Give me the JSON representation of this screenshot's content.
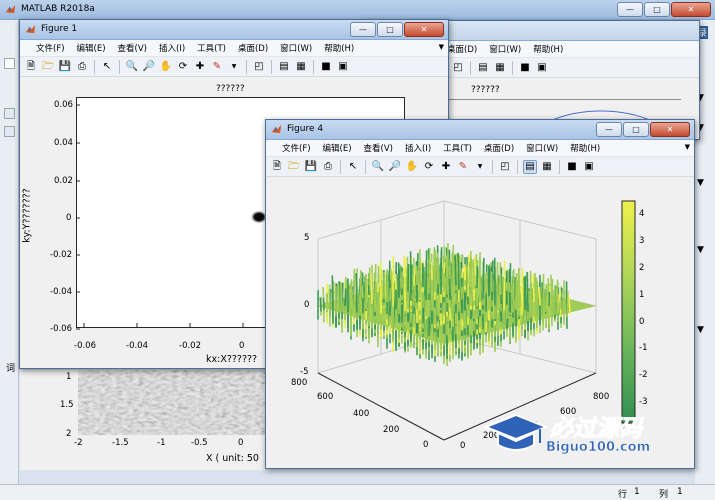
{
  "main": {
    "title": "MATLAB R2018a",
    "side_fragment": "录",
    "status": {
      "row_label": "行",
      "row_value": "1",
      "col_label": "列",
      "col_value": "1"
    }
  },
  "fig_menu": [
    "文件(F)",
    "编辑(E)",
    "查看(V)",
    "插入(I)",
    "工具(T)",
    "桌面(D)",
    "窗口(W)",
    "帮助(H)"
  ],
  "figure2": {
    "title": "??????"
  },
  "figure1": {
    "title": "Figure 1",
    "plot_title": "??????",
    "ylabel": "ky:Y???????",
    "xlabel": "kx:X??????",
    "yticks": [
      "0.06",
      "0.04",
      "0.02",
      "0",
      "-0.02",
      "-0.04",
      "-0.06"
    ],
    "xticks": [
      "-0.06",
      "-0.04",
      "-0.02",
      "0"
    ]
  },
  "behind_plot": {
    "yticks": [
      "1",
      "1.5",
      "2"
    ],
    "xticks": [
      "-2",
      "-1.5",
      "-1",
      "-0.5",
      "0"
    ],
    "xlabel": "X ( unit: 50"
  },
  "figure4": {
    "title": "Figure 4",
    "zticks": [
      "5",
      "0",
      "-5"
    ],
    "left_ticks": [
      "800",
      "600",
      "400",
      "200",
      "0"
    ],
    "right_ticks": [
      "800",
      "600",
      "400",
      "200",
      "0"
    ],
    "colorbar_ticks": [
      "4",
      "3",
      "2",
      "1",
      "0",
      "-1",
      "-2",
      "-3"
    ],
    "colors": {
      "low": "#3c9a55",
      "mid": "#9fcc55",
      "high": "#ecef4a"
    }
  },
  "watermark": {
    "brand": "必过源码",
    "url": "Biguo100.com"
  }
}
